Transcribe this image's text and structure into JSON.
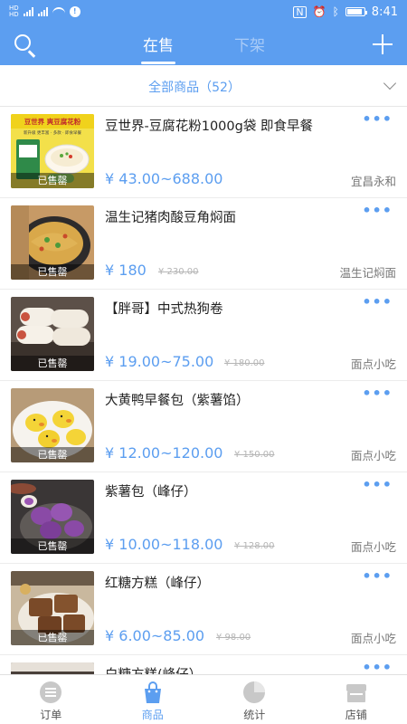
{
  "status_bar": {
    "left": [
      "HD",
      "4G",
      "HD",
      "4G"
    ],
    "time": "8:41"
  },
  "header": {
    "tabs": [
      {
        "label": "在售"
      },
      {
        "label": "下架"
      }
    ]
  },
  "filter": {
    "label": "全部商品（52）"
  },
  "products": [
    {
      "name": "豆世界-豆腐花粉1000g袋 即食早餐",
      "price": "¥ 43.00~688.00",
      "old_price": "",
      "shop": "宜昌永和",
      "sold_label": "已售罄"
    },
    {
      "name": "温生记猪肉酸豆角焖面",
      "price": "¥ 180",
      "old_price": "¥ 230.00",
      "shop": "温生记焖面",
      "sold_label": "已售罄"
    },
    {
      "name": "【胖哥】中式热狗卷",
      "price": "¥ 19.00~75.00",
      "old_price": "¥ 180.00",
      "shop": "面点小吃",
      "sold_label": "已售罄"
    },
    {
      "name": "大黄鸭早餐包（紫薯馅）",
      "price": "¥ 12.00~120.00",
      "old_price": "¥ 150.00",
      "shop": "面点小吃",
      "sold_label": "已售罄"
    },
    {
      "name": "紫薯包（峰仔）",
      "price": "¥ 10.00~118.00",
      "old_price": "¥ 128.00",
      "shop": "面点小吃",
      "sold_label": "已售罄"
    },
    {
      "name": "红糖方糕（峰仔）",
      "price": "¥ 6.00~85.00",
      "old_price": "¥ 98.00",
      "shop": "面点小吃",
      "sold_label": "已售罄"
    },
    {
      "name": "白糖方糕(峰仔）",
      "price": "",
      "old_price": "",
      "shop": "",
      "sold_label": ""
    }
  ],
  "thumb_art": {
    "p1_banner": "豆世界 爽豆腐花粉",
    "p1_sub": "新升级 更丰富 · 多款 · 即食早餐"
  },
  "bottom_nav": [
    {
      "label": "订单",
      "icon": "order-icon"
    },
    {
      "label": "商品",
      "icon": "goods-bag-icon"
    },
    {
      "label": "统计",
      "icon": "pie-chart-icon"
    },
    {
      "label": "店铺",
      "icon": "store-icon"
    }
  ],
  "colors": {
    "primary": "#5c9ef0",
    "inactive_tab": "#a9cbf7"
  }
}
